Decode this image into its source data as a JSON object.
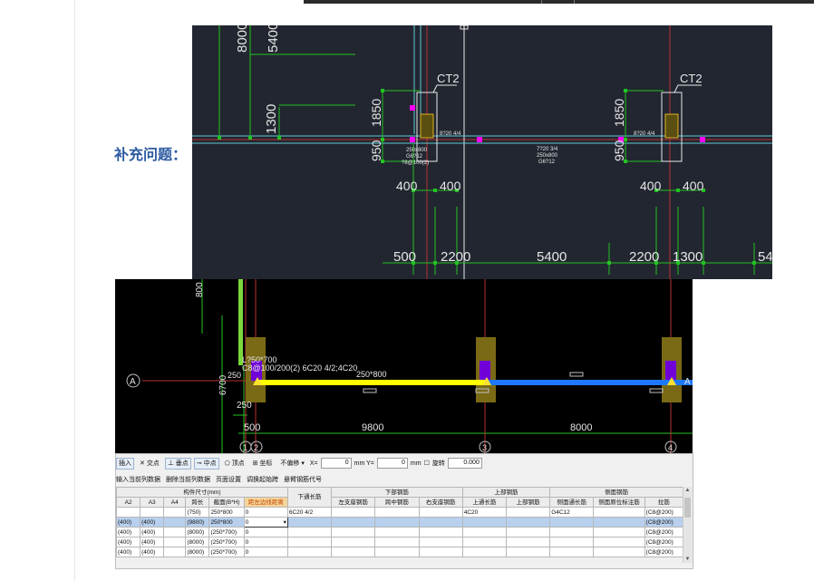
{
  "page": {
    "label": "补充问题："
  },
  "cad_top": {
    "dims_v": [
      "8000",
      "5400",
      "1300"
    ],
    "columns": [
      {
        "tag": "CT2",
        "dim_upper": "1850",
        "dim_lower": "950",
        "dim_left": "400",
        "dim_right": "400",
        "rebar_side": "8?20 4/4"
      },
      {
        "tag": "CT2",
        "dim_upper": "1850",
        "dim_lower": "950",
        "dim_left": "400",
        "dim_right": "400",
        "rebar_side": "8?20 4/4"
      }
    ],
    "beam_left": [
      "250x800",
      "G6?12",
      "?8@100(2)"
    ],
    "beam_mid": [
      "7?20 3/4",
      "250x800",
      "G6?12"
    ],
    "dims_h": [
      "500",
      "2200",
      "5400",
      "2200",
      "1300",
      "54"
    ]
  },
  "cad_bottom": {
    "dim_v": "800",
    "beam_text_1": "L?50*700",
    "beam_text_2": "C8@100/200(2) 6C20 4/2;4C20",
    "beam_size": "250*800",
    "dim_250": "250",
    "axis_a": "A",
    "dim_6700": "6700",
    "dims_h": [
      "500",
      "9800",
      "8000"
    ],
    "axes": [
      "1",
      "2",
      "3",
      "4"
    ]
  },
  "toolbar": {
    "insert": "插入",
    "intersection": "交点",
    "perpendicular": "垂点",
    "midpoint": "中点",
    "vertex": "顶点",
    "coordinate": "坐标",
    "offset": "不偏移",
    "x_label": "X=",
    "x_value": "0",
    "y_label": "mm Y=",
    "y_value": "0",
    "mm_label": "mm",
    "rotate": "旋转",
    "rotate_value": "0.000"
  },
  "menu": [
    "输入当前列数据",
    "删除当前列数据",
    "页面设置",
    "调换起始跨",
    "悬臂钢筋代号"
  ],
  "table": {
    "group_headers": [
      "构件尺寸(mm)",
      "下通长筋",
      "下部钢筋",
      "上部钢筋",
      "侧面钢筋"
    ],
    "columns": [
      "A2",
      "A3",
      "A4",
      "跨长",
      "截面(B*H)",
      "距左边线距离",
      "",
      "左支座钢筋",
      "跨中钢筋",
      "右支座钢筋",
      "上通长筋",
      "上部钢筋",
      "侧面通长筋",
      "侧面原位标注筋",
      "拉筋"
    ],
    "rows": [
      [
        "",
        "",
        "",
        "(750)",
        "250*800",
        "0",
        "6C20 4/2",
        "",
        "",
        "",
        "4C20",
        "",
        "G4C12",
        "",
        "(C8@200)"
      ],
      [
        "(400)",
        "(400)",
        "",
        "(9800)",
        "250*800",
        "0",
        "",
        "",
        "",
        "",
        "",
        "",
        "",
        "",
        "(C8@200)"
      ],
      [
        "(400)",
        "(400)",
        "",
        "(8000)",
        "(250*700)",
        "0",
        "",
        "",
        "",
        "",
        "",
        "",
        "",
        "",
        "(C8@200)"
      ],
      [
        "(400)",
        "(400)",
        "",
        "(8000)",
        "(250*700)",
        "0",
        "",
        "",
        "",
        "",
        "",
        "",
        "",
        "",
        "(C8@200)"
      ],
      [
        "(400)",
        "(400)",
        "",
        "(8000)",
        "(250*700)",
        "0",
        "",
        "",
        "",
        "",
        "",
        "",
        "",
        "",
        "(C8@200)"
      ]
    ]
  },
  "colors": {
    "label": "#2c5aa0",
    "cad_bg": "#222630",
    "dim_green": "#22c322",
    "axis_red": "#b83232",
    "beam_cyan": "#5ecbd3",
    "yellow_beam": "#ffff00",
    "blue_beam": "#1e78ff",
    "column_olive": "#7a6a16",
    "magenta": "#ff00ff"
  }
}
